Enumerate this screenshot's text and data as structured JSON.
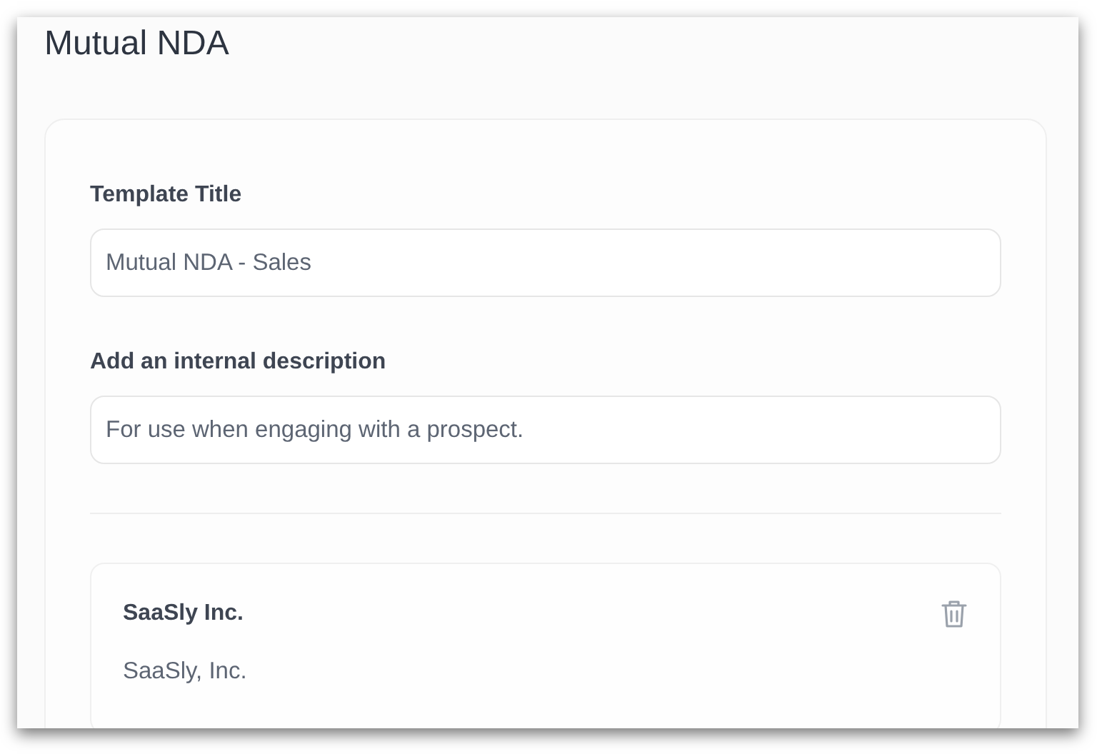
{
  "page": {
    "title": "Mutual NDA"
  },
  "form": {
    "fields": [
      {
        "label": "Template Title",
        "value": "Mutual NDA - Sales"
      },
      {
        "label": "Add an internal description",
        "value": "For use when engaging with a prospect."
      }
    ]
  },
  "parties": [
    {
      "name": "SaaSly Inc.",
      "legal_name": "SaaSly, Inc."
    }
  ]
}
